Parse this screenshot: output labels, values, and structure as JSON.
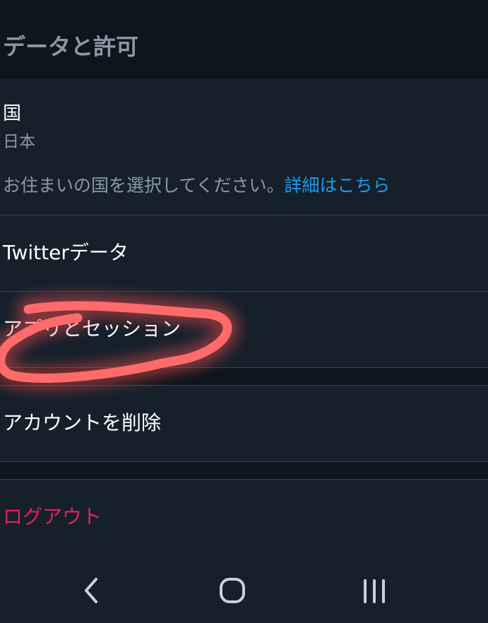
{
  "header": {
    "title": "データと許可"
  },
  "country": {
    "label": "国",
    "value": "日本",
    "description": "お住まいの国を選択してください。",
    "link": "詳細はこちら"
  },
  "menu": {
    "twitter_data": "Twitterデータ",
    "apps_sessions": "アプリとセッション",
    "delete_account": "アカウントを削除",
    "logout": "ログアウト"
  },
  "colors": {
    "background": "#15202b",
    "header_background": "#0e151c",
    "link": "#1d9bf0",
    "danger": "#e0245e",
    "secondary_text": "#8b98a5",
    "annotation": "#ff5a5a"
  },
  "annotation": {
    "type": "hand-drawn-circle",
    "target": "apps_sessions"
  },
  "navigation": {
    "icons": [
      "back-icon",
      "home-icon",
      "recent-apps-icon"
    ]
  }
}
